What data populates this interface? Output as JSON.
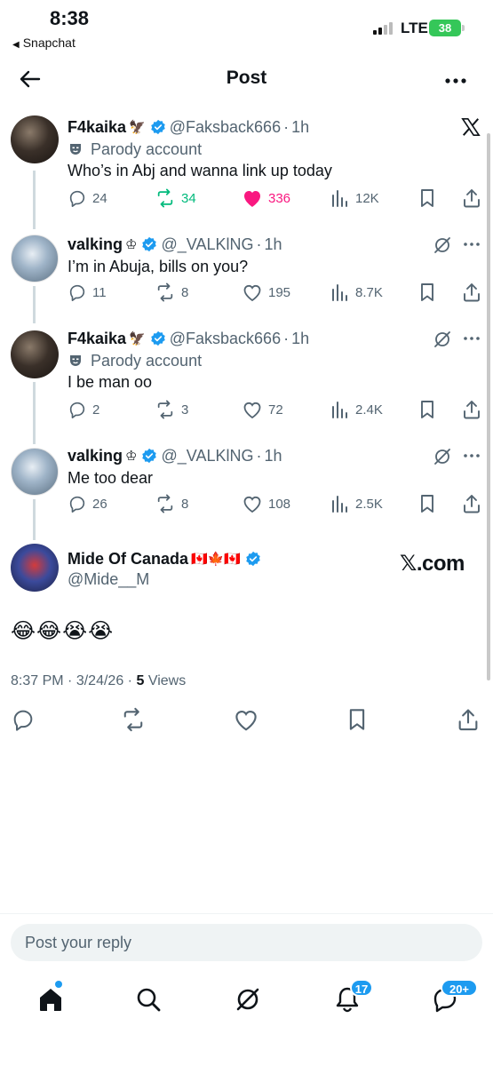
{
  "status_bar": {
    "time": "8:38",
    "back_app": "Snapchat",
    "network": "LTE",
    "battery": "38"
  },
  "header": {
    "title": "Post"
  },
  "posts": [
    {
      "name": "F4kaika",
      "emoji": "🦅",
      "handle": "@Faksback666",
      "age": "1h",
      "parody": "Parody account",
      "text": "Who’s in Abj and wanna link up today",
      "replies": "24",
      "reposts": "34",
      "likes": "336",
      "views": "12K",
      "reposted": true,
      "liked": true
    },
    {
      "name": "valking",
      "emoji": "♔",
      "handle": "@_VALKlNG",
      "age": "1h",
      "text": "I’m in Abuja, bills on you?",
      "replies": "11",
      "reposts": "8",
      "likes": "195",
      "views": "8.7K"
    },
    {
      "name": "F4kaika",
      "emoji": "🦅",
      "handle": "@Faksback666",
      "age": "1h",
      "parody": "Parody account",
      "text": "I be man oo",
      "replies": "2",
      "reposts": "3",
      "likes": "72",
      "views": "2.4K"
    },
    {
      "name": "valking",
      "emoji": "♔",
      "handle": "@_VALKlNG",
      "age": "1h",
      "text": "Me too dear",
      "replies": "26",
      "reposts": "8",
      "likes": "108",
      "views": "2.5K"
    }
  ],
  "main_post": {
    "name": "Mide Of Canada",
    "emoji": "🇨🇦🍁🇨🇦",
    "handle": "@Mide__M",
    "watermark": "𝕏.com",
    "text": "😂😂😭😭",
    "time": "8:37 PM",
    "date": "3/24/26",
    "views_count": "5",
    "views_label": "Views"
  },
  "reply_box": {
    "placeholder": "Post your reply"
  },
  "tabbar": {
    "notifications_badge": "17",
    "messages_badge": "20+"
  },
  "colors": {
    "accent": "#1d9bf0",
    "repost_green": "#00ba7c",
    "like_pink": "#f91880",
    "secondary_text": "#536471"
  },
  "icons": {
    "logo": "x-logo-icon",
    "verified": "verified-badge-icon",
    "grok": "grok-icon"
  }
}
